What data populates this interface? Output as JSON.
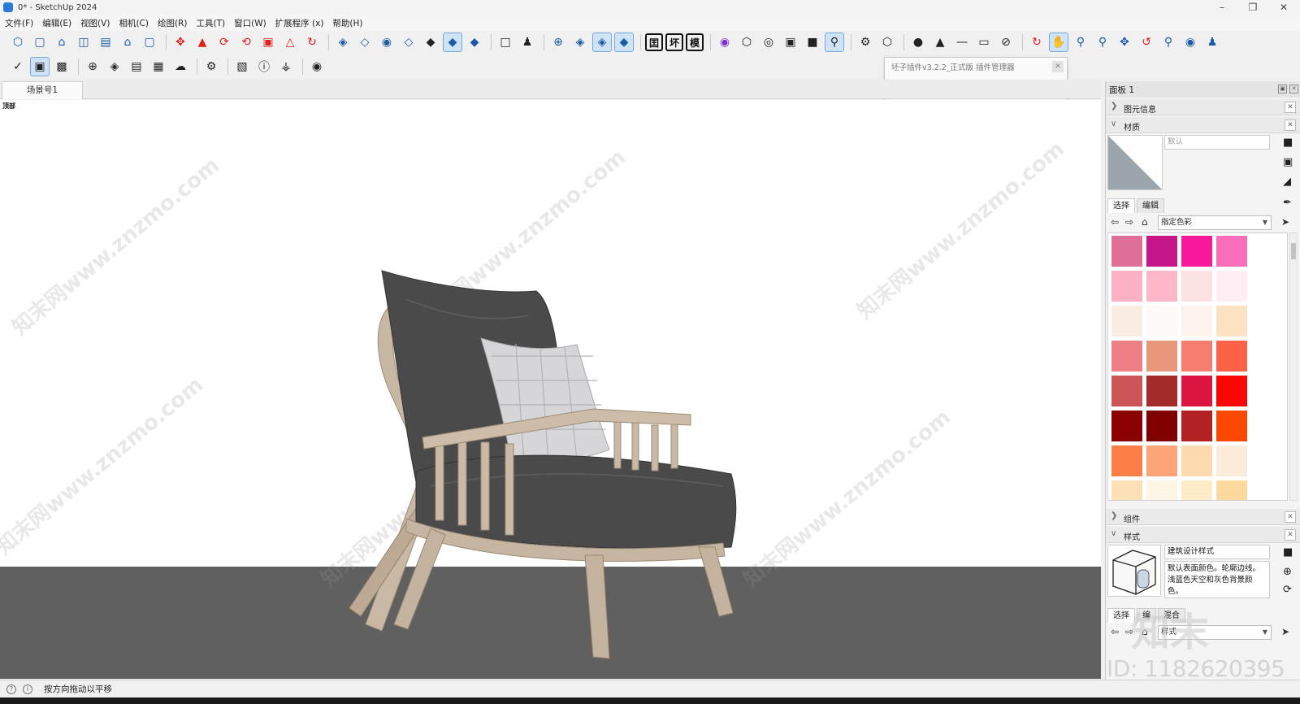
{
  "window": {
    "title": "0* - SketchUp 2024"
  },
  "menu": [
    "文件(F)",
    "编辑(E)",
    "视图(V)",
    "相机(C)",
    "绘图(R)",
    "工具(T)",
    "窗口(W)",
    "扩展程序 (x)",
    "帮助(H)"
  ],
  "toolbar_boxes": [
    "囯",
    "坏",
    "模"
  ],
  "scene_tab": "场景号1",
  "viewport": {
    "label": "顶部"
  },
  "plugin_popup": {
    "title": "坯子插件v3.2.2_正式版 插件管理器",
    "search_value": ""
  },
  "panel": {
    "title": "面板 1",
    "entity_info": "图元信息",
    "materials": {
      "title": "材质",
      "name_placeholder": "默认",
      "tab_select": "选择",
      "tab_edit": "编辑",
      "collection": "指定色彩",
      "swatches": [
        "#de6f96",
        "#c6168a",
        "#f8199a",
        "#f96eb9",
        "#fcb2c4",
        "#fcb6c8",
        "#fde2e2",
        "#fdeef3",
        "#f9ede1",
        "#fdf9f6",
        "#fdf3ec",
        "#fde1c3",
        "#ee7f84",
        "#e8987a",
        "#f67e6e",
        "#fd6246",
        "#cc5557",
        "#a52a2a",
        "#dd1540",
        "#fb0505",
        "#8b0000",
        "#800000",
        "#b22222",
        "#fd4801",
        "#fe7e48",
        "#fda579",
        "#fddab0",
        "#fdebda",
        "#fde0b5",
        "#fdf5e4",
        "#fdebc9",
        "#fdd99e"
      ]
    },
    "components": "组件",
    "styles": {
      "title": "样式",
      "name": "建筑设计样式",
      "description": "默认表面颜色。轮廓边线。浅蓝色天空和灰色背景颜色。",
      "tab_select": "选择",
      "tab_edit": "编",
      "tab_mix": "混合",
      "collection": "样式"
    }
  },
  "status": {
    "text": "按方向拖动以平移"
  },
  "watermarks": {
    "site": "知末网www.znzmo.com",
    "brand": "知末",
    "id": "ID: 1182620395"
  },
  "colors": {
    "ground": "#606060",
    "viewport_bg": "#ffffff",
    "accent": "#1c5aa6"
  }
}
